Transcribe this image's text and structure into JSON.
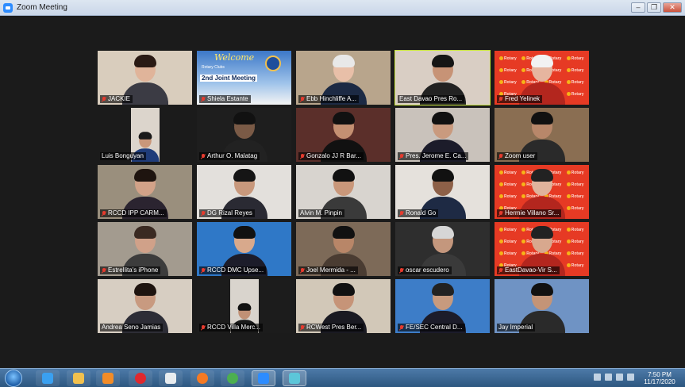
{
  "window": {
    "title": "Zoom Meeting",
    "controls": [
      "minimize",
      "restore",
      "close"
    ]
  },
  "participants": [
    {
      "name": "JACKIE",
      "muted": true,
      "bg": "#d9cdbd",
      "skin": "#e0b49a",
      "hair": "#2a1a14",
      "shirt": "#3b3b44"
    },
    {
      "name": "Shiela Estante",
      "muted": true,
      "bg": "#3b6fb2",
      "skin": "#d6a88a",
      "hair": "#222",
      "shirt": "#4a4a4a",
      "slide": {
        "welcome": "Welcome",
        "heading": "2nd Joint Meeting",
        "sub": "Rotary Clubs"
      }
    },
    {
      "name": "Ebb Hinchliffe A...",
      "muted": true,
      "bg": "#b8a58c",
      "skin": "#e8bfa8",
      "hair": "#e8e8e8",
      "shirt": "#1c2a44"
    },
    {
      "name": "East Davao Pres Ro...",
      "muted": false,
      "active": true,
      "bg": "#d9cec4",
      "skin": "#c79376",
      "hair": "#151515",
      "shirt": "#222"
    },
    {
      "name": "Fred Yelinek",
      "muted": true,
      "rotary": true,
      "skin": "#e6b59f",
      "hair": "#f2f2f2",
      "shirt": "#b3261e"
    },
    {
      "name": "Luis Bonguyan",
      "muted": false,
      "bg": "#1b1b1b",
      "inner_bg": "#dcd5cc",
      "skin": "#c9977a",
      "hair": "#1a1a1a",
      "shirt": "#1f3c7a"
    },
    {
      "name": "Arthur O. Malatag",
      "muted": true,
      "bg": "#1e1e1e",
      "skin": "#7a5a46",
      "hair": "#111",
      "shirt": "#222"
    },
    {
      "name": "Gonzalo JJ R Bar...",
      "muted": true,
      "bg": "#5b2f2a",
      "skin": "#c49072",
      "hair": "#111",
      "shirt": "#111"
    },
    {
      "name": "Pres. Jerome E. Ca...",
      "muted": true,
      "bg": "#c9c2bb",
      "skin": "#c99a7e",
      "hair": "#111",
      "shirt": "#1c1c2a"
    },
    {
      "name": "Zoom user",
      "muted": true,
      "bg": "#8a6e52",
      "skin": "#b8876a",
      "hair": "#111",
      "shirt": "#2a2a2a"
    },
    {
      "name": "RCCD IPP CARM...",
      "muted": true,
      "bg": "#9a8f7d",
      "skin": "#d2a288",
      "hair": "#1e140f",
      "shirt": "#2b2430"
    },
    {
      "name": "DG Rizal Reyes",
      "muted": true,
      "bg": "#e3e0dc",
      "skin": "#c8987c",
      "hair": "#151515",
      "shirt": "#2a2a33"
    },
    {
      "name": "Alvin M. Pinpin",
      "muted": false,
      "bg": "#d8d4cf",
      "skin": "#c9977a",
      "hair": "#111",
      "shirt": "#3a3a3a"
    },
    {
      "name": "Ronald Go",
      "muted": true,
      "bg": "#e5e1dc",
      "skin": "#8d6048",
      "hair": "#111",
      "shirt": "#1e2a44"
    },
    {
      "name": "Hermie Villano Sr...",
      "muted": true,
      "rotary": true,
      "skin": "#e0b39c",
      "hair": "#222",
      "shirt": "#b3261e"
    },
    {
      "name": "Estrellita's iPhone",
      "muted": true,
      "bg": "#a39b8f",
      "skin": "#d0a189",
      "hair": "#3a2a22",
      "shirt": "#3c3c3c"
    },
    {
      "name": "RCCD DMC Upse...",
      "muted": true,
      "bg": "#2f78c7",
      "skin": "#d8a98c",
      "hair": "#111",
      "shirt": "#1c1c2a"
    },
    {
      "name": "Joel Mermida - ...",
      "muted": true,
      "bg": "#7d6a58",
      "skin": "#b88668",
      "hair": "#111",
      "shirt": "#4a3c32"
    },
    {
      "name": "oscar escudero",
      "muted": true,
      "bg": "#2e2e2e",
      "skin": "#c4977d",
      "hair": "#d6d6d6",
      "shirt": "#3a3a3a"
    },
    {
      "name": "EastDavao-Vir S...",
      "muted": true,
      "rotary": true,
      "skin": "#d8a88e",
      "hair": "#222",
      "shirt": "#b3261e"
    },
    {
      "name": "Andrea Seno Jamias",
      "muted": false,
      "bg": "#d7cec2",
      "skin": "#c89a80",
      "hair": "#1e140f",
      "shirt": "#2d2d36"
    },
    {
      "name": "RCCD Villa Merc...",
      "muted": true,
      "bg": "#1c1c1c",
      "inner_bg": "#d9d4cd",
      "skin": "#c09075",
      "hair": "#111",
      "shirt": "#1a1a1a"
    },
    {
      "name": "RCWest Pres Ber...",
      "muted": true,
      "bg": "#d2c8b8",
      "skin": "#c69478",
      "hair": "#111",
      "shirt": "#1a1a22"
    },
    {
      "name": "FE/SEC Central D...",
      "muted": true,
      "bg": "#3d7dc8",
      "skin": "#c79a7e",
      "hair": "#222",
      "shirt": "#1c1c2a"
    },
    {
      "name": "Jay Imperial",
      "muted": false,
      "bg": "#6f93c4",
      "skin": "#c49477",
      "hair": "#111",
      "shirt": "#2a2a2a"
    }
  ],
  "rotary_label": "Rotary",
  "taskbar": {
    "apps": [
      {
        "icon": "internet-explorer-icon",
        "color": "#3aa0f0"
      },
      {
        "icon": "folder-icon",
        "color": "#f2c14e"
      },
      {
        "icon": "media-player-icon",
        "color": "#f28c28"
      },
      {
        "icon": "opera-icon",
        "color": "#e0282e"
      },
      {
        "icon": "document-icon",
        "color": "#e8ecef"
      },
      {
        "icon": "firefox-icon",
        "color": "#f57a24"
      },
      {
        "icon": "chrome-icon",
        "color": "#4caf50"
      },
      {
        "icon": "zoom-icon",
        "color": "#2d8cff"
      },
      {
        "icon": "photos-icon",
        "color": "#5cc6d9"
      }
    ],
    "time": "7:50 PM",
    "date": "11/17/2020"
  }
}
